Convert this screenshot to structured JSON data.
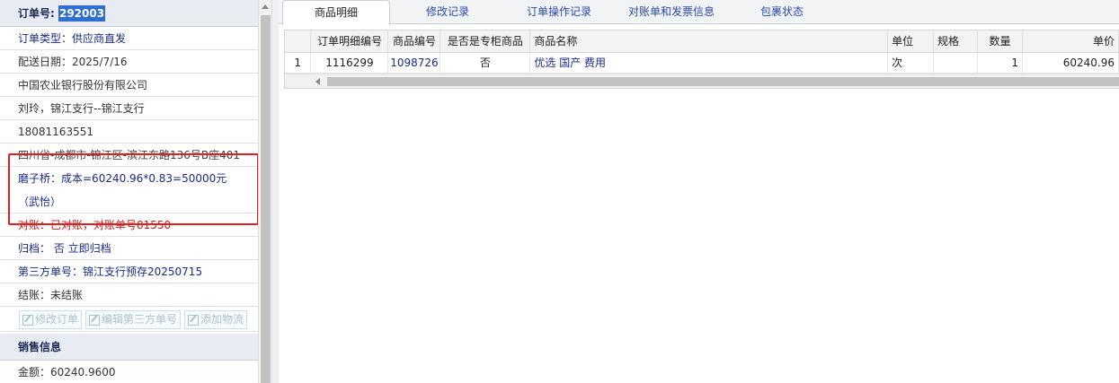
{
  "order": {
    "title_label": "订单号: ",
    "title_number": "292003",
    "type": "订单类型：供应商直发",
    "delivery_date": "配送日期：2025/7/16",
    "company": "中国农业银行股份有限公司",
    "contact": "刘玲，锦江支行--锦江支行",
    "phone": "18081163551",
    "address": "四川省-成都市-锦江区-滨江东路136号B座401",
    "remark": "磨子桥：成本=60240.96*0.83=50000元（武怡）",
    "reconcile": "对账：已对账，对账单号81550",
    "archive": "归档：  否  立即归档",
    "third_party": "第三方单号：锦江支行预存20250715",
    "settlement": "结账：未结账",
    "buttons": {
      "edit_order": "修改订单",
      "edit_third_party": "编辑第三方单号",
      "add_logistics": "添加物流"
    }
  },
  "sales": {
    "title": "销售信息",
    "amount": "金额：60240.9600"
  },
  "tabs": [
    "商品明细",
    "修改记录",
    "订单操作记录",
    "对账单和发票信息",
    "包裹状态"
  ],
  "table": {
    "headers": [
      "",
      "订单明细编号",
      "商品编号",
      "是否是专柜商品",
      "商品名称",
      "单位",
      "规格",
      "数量",
      "单价"
    ],
    "rows": [
      [
        "1",
        "1116299",
        "1098726",
        "否",
        "优选 国产 费用",
        "次",
        "",
        "1",
        "60240.96"
      ]
    ]
  }
}
